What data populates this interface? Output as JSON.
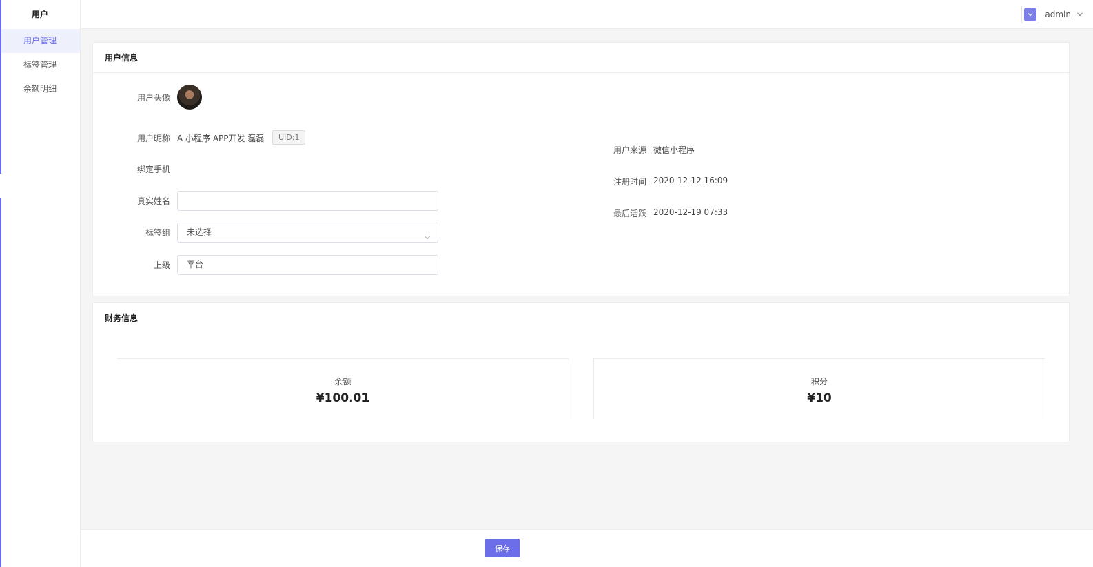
{
  "sidebar": {
    "title": "用户",
    "items": [
      {
        "label": "用户管理"
      },
      {
        "label": "标签管理"
      },
      {
        "label": "余额明细"
      }
    ]
  },
  "header": {
    "username": "admin"
  },
  "user_info": {
    "section_title": "用户信息",
    "avatar_label": "用户头像",
    "nickname_label": "用户昵称",
    "nickname": "A 小程序 APP开发 磊磊",
    "uid_badge": "UID:1",
    "phone_label": "绑定手机",
    "realname_label": "真实姓名",
    "realname_value": "",
    "tag_group_label": "标签组",
    "tag_group_value": "未选择",
    "superior_label": "上级",
    "superior_value": "平台",
    "source_label": "用户来源",
    "source_value": "微信小程序",
    "register_label": "注册时间",
    "register_value": "2020-12-12 16:09",
    "last_active_label": "最后活跃",
    "last_active_value": "2020-12-19 07:33"
  },
  "finance": {
    "section_title": "财务信息",
    "balance_label": "余额",
    "balance_value": "¥100.01",
    "points_label": "积分",
    "points_value": "¥10"
  },
  "footer": {
    "save_label": "保存"
  },
  "colors": {
    "accent": "#6b6ee8",
    "background": "#f5f5f5"
  }
}
